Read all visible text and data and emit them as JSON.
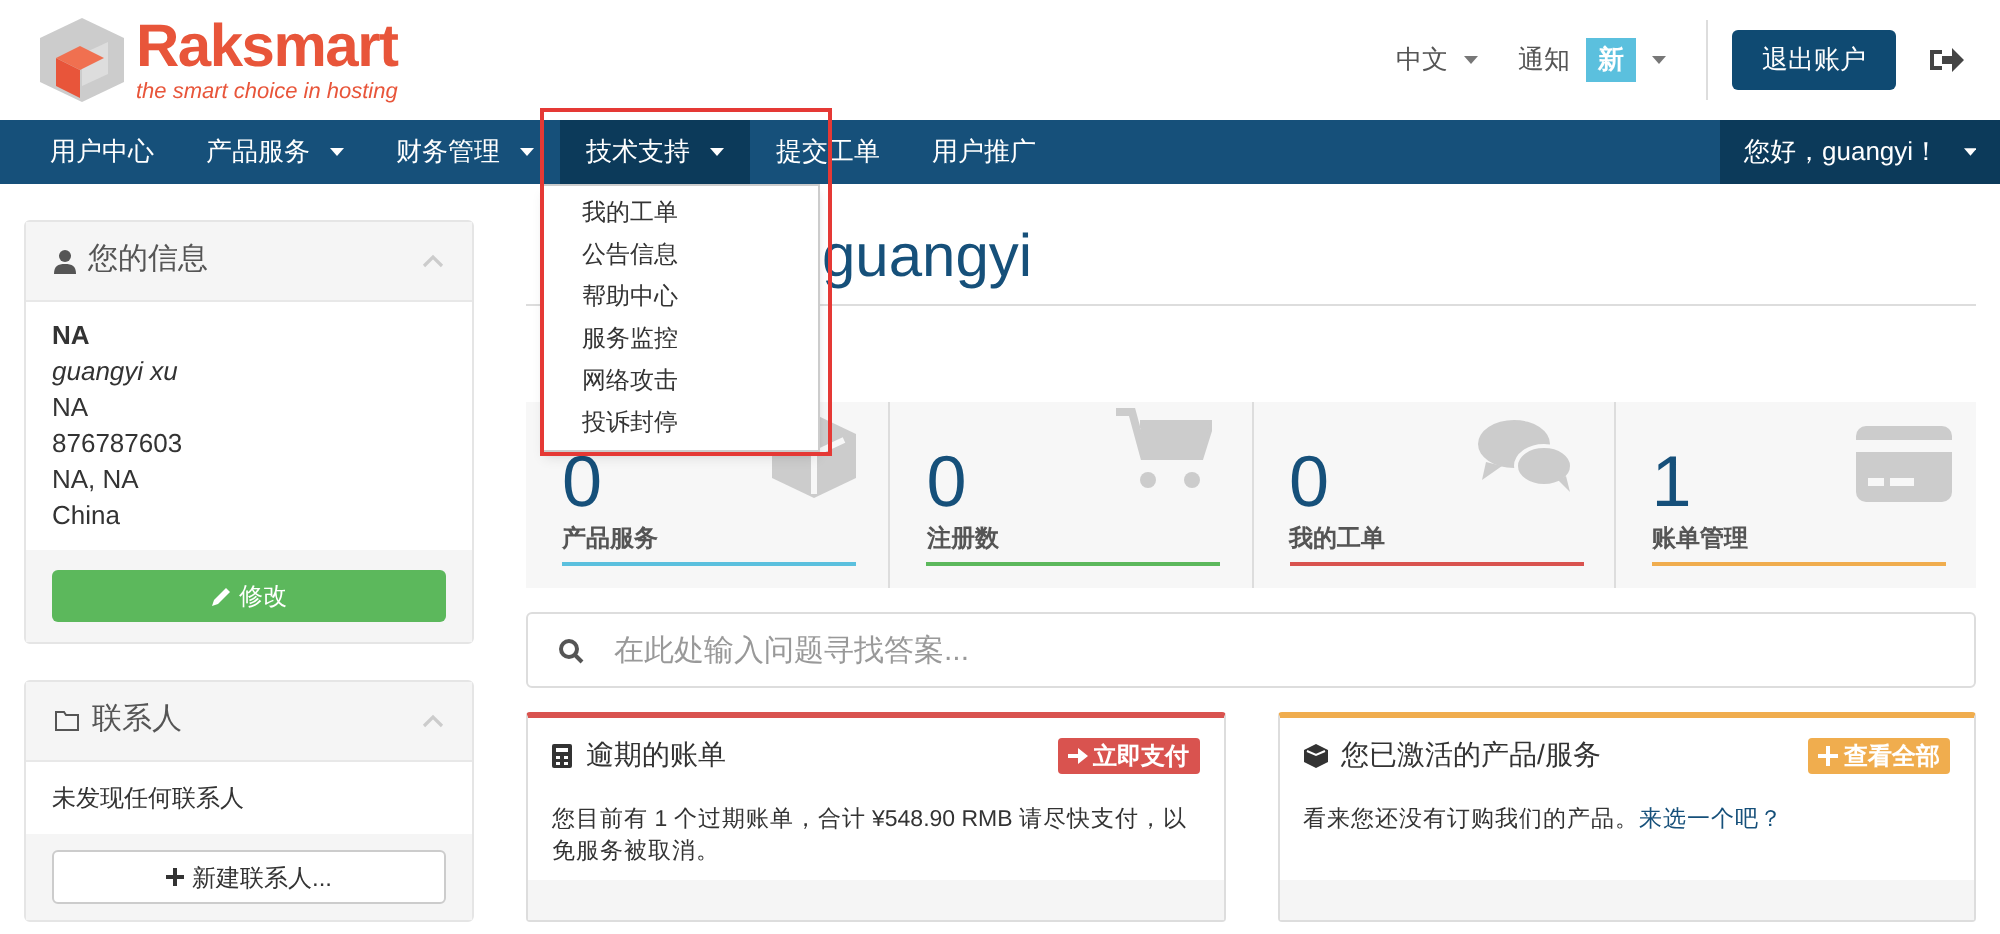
{
  "logo": {
    "name": "Raksmart",
    "tagline": "the smart choice in hosting"
  },
  "top_links": [
    {
      "label": "中文",
      "kind": "dropdown"
    },
    {
      "label": "通知",
      "kind": "notify",
      "badge": "新"
    }
  ],
  "logout_button": "退出账户",
  "nav": [
    {
      "label": "用户中心",
      "dropdown": false,
      "selected": false
    },
    {
      "label": "产品服务",
      "dropdown": true,
      "selected": false
    },
    {
      "label": "财务管理",
      "dropdown": true,
      "selected": false
    },
    {
      "label": "技术支持",
      "dropdown": true,
      "selected": true
    },
    {
      "label": "提交工单",
      "dropdown": false,
      "selected": false
    },
    {
      "label": "用户推广",
      "dropdown": false,
      "selected": false
    }
  ],
  "user_menu": "您好，guangyi！",
  "dropdown_menu": [
    "我的工单",
    "公告信息",
    "帮助中心",
    "服务监控",
    "网络攻击",
    "投诉封停"
  ],
  "info_panel": {
    "title": "您的信息",
    "name": "NA",
    "full_name": "guangyi xu",
    "lines": [
      "NA",
      "876787603",
      "NA, NA",
      "China"
    ],
    "button": "修改"
  },
  "contacts_panel": {
    "title": "联系人",
    "empty_text": "未发现任何联系人",
    "button": "新建联系人..."
  },
  "heading": "guangyi",
  "stats": [
    {
      "value": "0",
      "label": "产品服务",
      "color": "#5bc0de"
    },
    {
      "value": "0",
      "label": "注册数",
      "color": "#5cb85c"
    },
    {
      "value": "0",
      "label": "我的工单",
      "color": "#d9534f"
    },
    {
      "value": "1",
      "label": "账单管理",
      "color": "#f0ad4e"
    }
  ],
  "search": {
    "placeholder": "在此处输入问题寻找答案..."
  },
  "panels": [
    {
      "title": "逾期的账单",
      "color": "#d9534f",
      "action": "立即支付",
      "body": "您目前有 1 个过期账单，合计 ¥548.90 RMB 请尽快支付，以免服务被取消。"
    },
    {
      "title": "您已激活的产品/服务",
      "color": "#f0ad4e",
      "action": "查看全部",
      "body": "看来您还没有订购我们的产品。",
      "link": "来选一个吧？"
    }
  ]
}
